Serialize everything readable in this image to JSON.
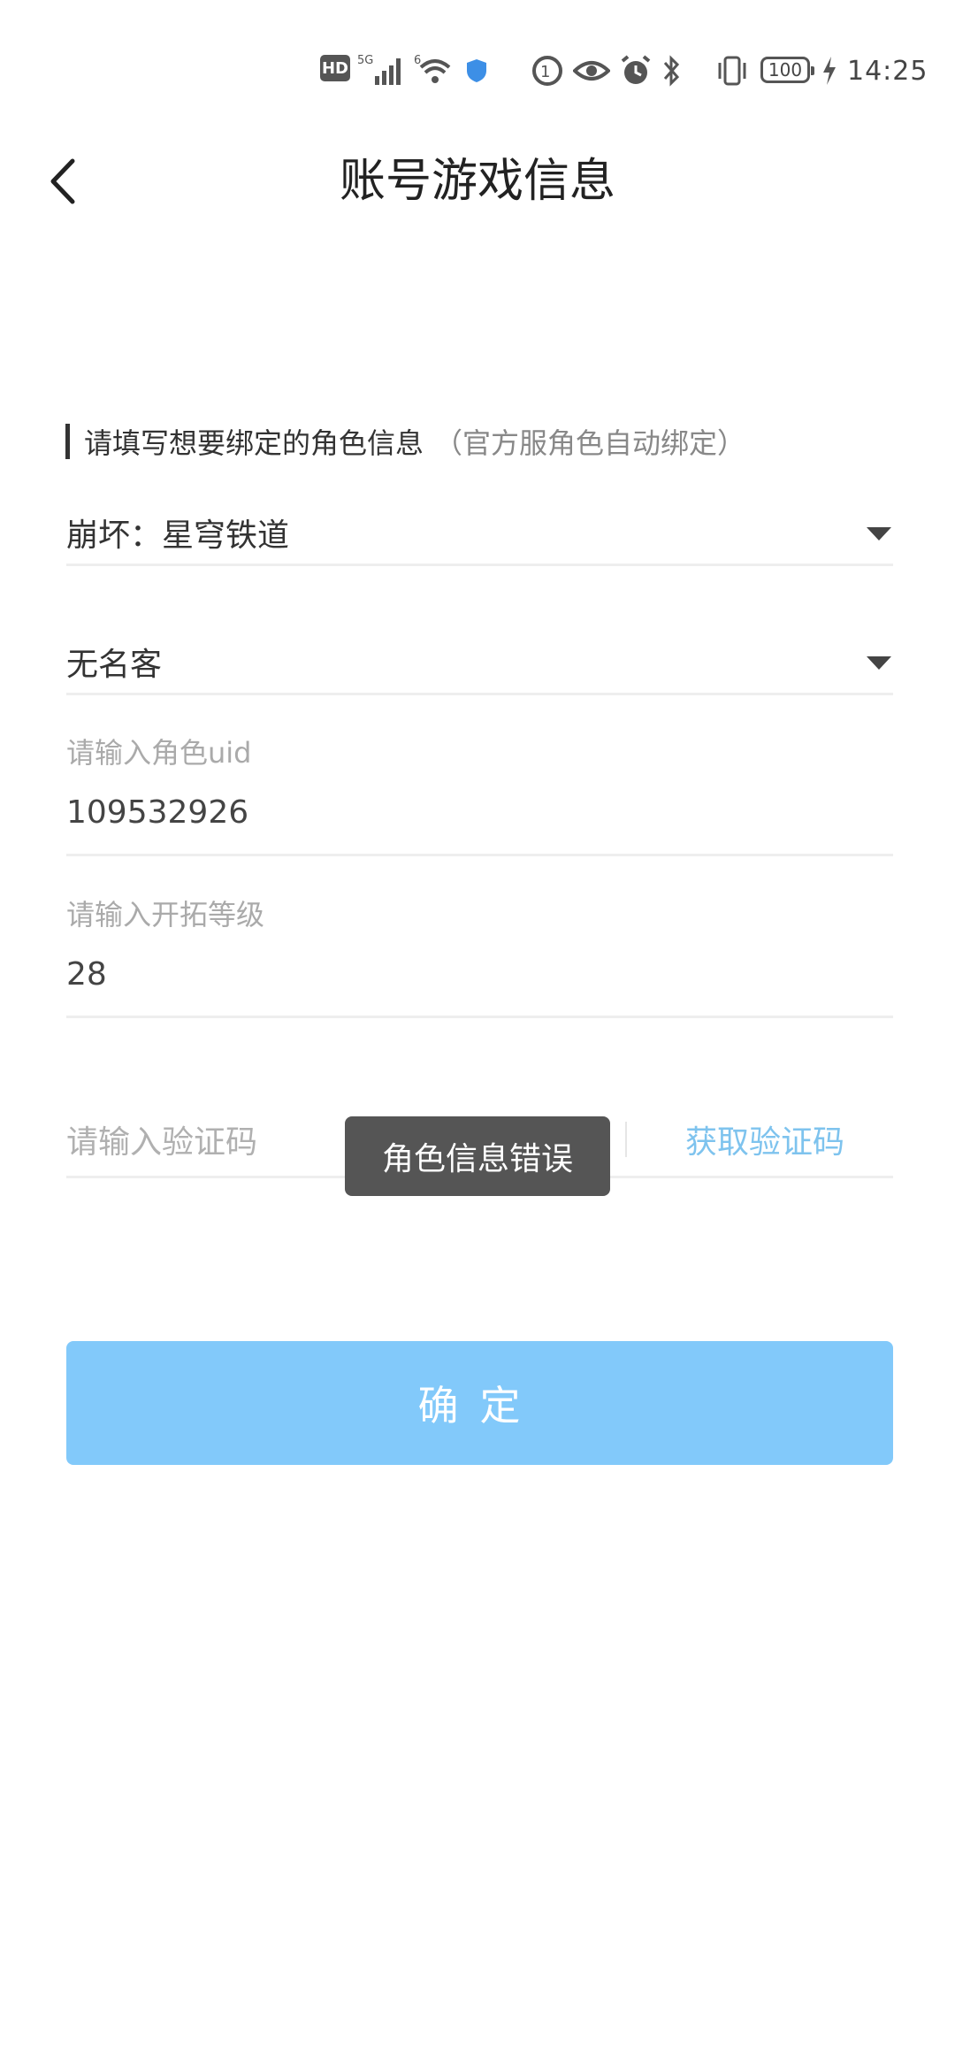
{
  "status_bar": {
    "hd": "HD",
    "network": "5G",
    "wifi_num": "6",
    "battery": "100",
    "time": "14:25"
  },
  "header": {
    "title": "账号游戏信息",
    "back_icon": "chevron-left-icon"
  },
  "section": {
    "title": "请填写想要绑定的角色信息",
    "note": "（官方服角色自动绑定）"
  },
  "game_select": {
    "value": "崩坏：星穹铁道"
  },
  "server_select": {
    "value": "无名客"
  },
  "uid_field": {
    "label": "请输入角色uid",
    "value": "109532926"
  },
  "level_field": {
    "label": "请输入开拓等级",
    "value": "28"
  },
  "verify_field": {
    "placeholder": "请输入验证码",
    "button": "获取验证码"
  },
  "toast": {
    "text": "角色信息错误"
  },
  "confirm": {
    "label": "确定"
  },
  "colors": {
    "accent": "#82c9fa",
    "link": "#7ec3ee",
    "toast_bg": "#555555"
  }
}
